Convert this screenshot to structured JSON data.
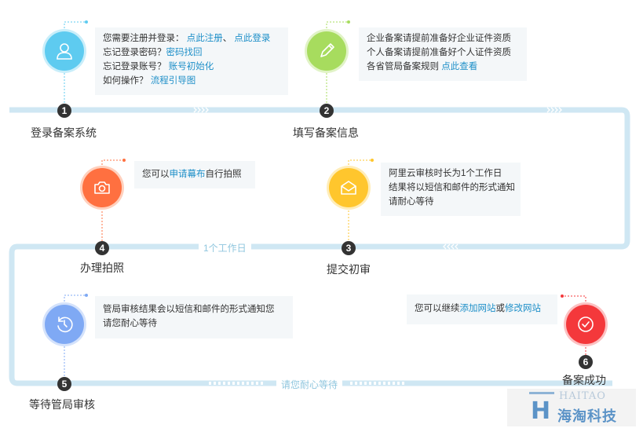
{
  "colors": {
    "track": "#cfe7f3",
    "step1": "#5ecbf0",
    "step2": "#a7dc5e",
    "step3": "#ffc62d",
    "step4": "#ff7040",
    "step5": "#7fa9f4",
    "step6": "#f4383b",
    "link": "#1e8fc8"
  },
  "track_labels": {
    "upper_middle": "1个工作日",
    "bottom_middle": "请您耐心等待"
  },
  "steps": [
    {
      "number": "1",
      "title": "登录备案系统",
      "icon": "user-icon",
      "lines": [
        [
          {
            "t": "您需要注册并登录：  "
          },
          {
            "t": "点此注册",
            "link": true
          },
          {
            "t": "、  "
          },
          {
            "t": "点此登录",
            "link": true
          }
        ],
        [
          {
            "t": "忘记登录密码？"
          },
          {
            "t": "密码找回",
            "link": true
          }
        ],
        [
          {
            "t": "忘记登录账号？  "
          },
          {
            "t": "账号初始化",
            "link": true
          }
        ],
        [
          {
            "t": "如何操作？  "
          },
          {
            "t": "流程引导图",
            "link": true
          }
        ]
      ]
    },
    {
      "number": "2",
      "title": "填写备案信息",
      "icon": "pencil-icon",
      "lines": [
        [
          {
            "t": "企业备案请提前准备好企业证件资质"
          }
        ],
        [
          {
            "t": "个人备案请提前准备好个人证件资质"
          }
        ],
        [
          {
            "t": "各省管局备案规则  "
          },
          {
            "t": "点此查看",
            "link": true
          }
        ]
      ]
    },
    {
      "number": "3",
      "title": "提交初审",
      "icon": "envelope-icon",
      "lines": [
        [
          {
            "t": "阿里云审核时长为1个工作日"
          }
        ],
        [
          {
            "t": "结果将以短信和邮件的形式通知"
          }
        ],
        [
          {
            "t": "请耐心等待"
          }
        ]
      ]
    },
    {
      "number": "4",
      "title": "办理拍照",
      "icon": "camera-icon",
      "lines": [
        [
          {
            "t": "您可以"
          },
          {
            "t": "申请幕布",
            "link": true
          },
          {
            "t": "自行拍照"
          }
        ]
      ]
    },
    {
      "number": "5",
      "title": "等待管局审核",
      "icon": "clock-icon",
      "lines": [
        [
          {
            "t": "管局审核结果会以短信和邮件的形式通知您"
          }
        ],
        [
          {
            "t": "请您耐心等待"
          }
        ]
      ]
    },
    {
      "number": "6",
      "title": "备案成功",
      "icon": "check-icon",
      "lines": [
        [
          {
            "t": "您可以继续"
          },
          {
            "t": "添加网站",
            "link": true
          },
          {
            "t": "或"
          },
          {
            "t": "修改网站",
            "link": true
          }
        ]
      ]
    }
  ],
  "logo": {
    "letter": "H",
    "en": "HAITAO",
    "cn": "海淘科技"
  }
}
